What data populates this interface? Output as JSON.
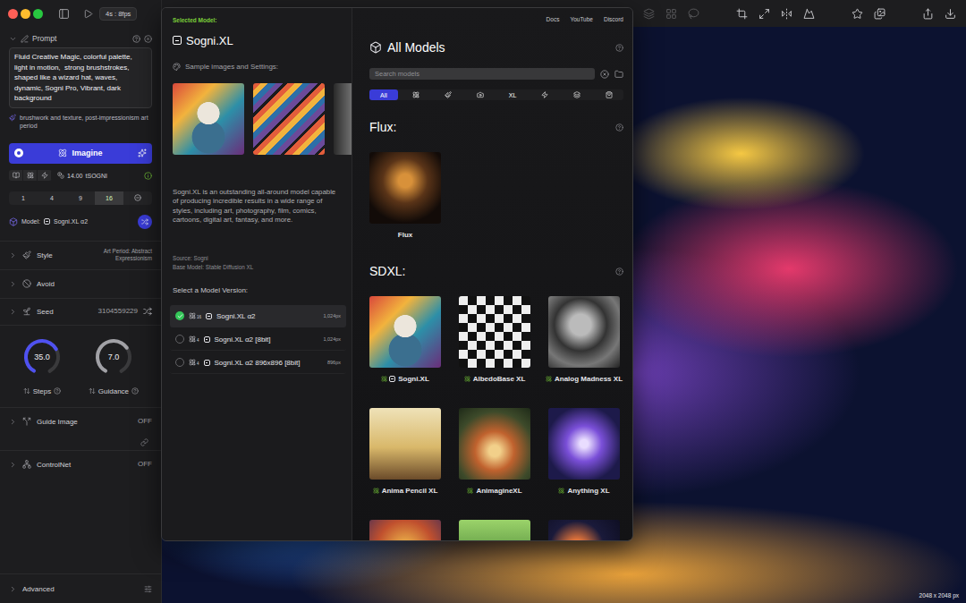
{
  "window": {
    "playback": "4s : 8fps"
  },
  "sidebar": {
    "prompt": {
      "label": "Prompt",
      "expanded": true,
      "text": "Fluid Creative Magic, colorful palette, light in motion,  strong brushstrokes, shaped like a wizard hat, waves, dynamic, Sogni Pro, Vibrant, dark background"
    },
    "style_hint": "brushwork and texture, post-impressionism art period",
    "imagine_button": "Imagine",
    "cost": {
      "amount": "14.00",
      "unit": "tSOGNI"
    },
    "batch": [
      {
        "label": "1",
        "selected": false
      },
      {
        "label": "4",
        "selected": false
      },
      {
        "label": "9",
        "selected": false
      },
      {
        "label": "16",
        "selected": true
      }
    ],
    "model": {
      "label": "Model:",
      "name": "Sogni.XL α2"
    },
    "sections": [
      {
        "label": "Style",
        "value": "Art Period: Abstract Expressionism",
        "expanded": false
      },
      {
        "label": "Avoid",
        "value": "",
        "expanded": false
      },
      {
        "label": "Seed",
        "value": "3104559229",
        "expanded": false
      }
    ],
    "dials": [
      {
        "label": "Steps",
        "value": "35.0",
        "level": 0.7,
        "color": "#4f51f0"
      },
      {
        "label": "Guidance",
        "value": "7.0",
        "level": 0.68,
        "color": "#a1a1a6"
      }
    ],
    "toggles": [
      {
        "label": "Guide Image",
        "value": "OFF",
        "expanded": false
      },
      {
        "label": "ControlNet",
        "value": "OFF",
        "expanded": false
      }
    ],
    "advanced": {
      "label": "Advanced",
      "expanded": false
    }
  },
  "toolbar": [
    {
      "disabled": true
    },
    {
      "disabled": true
    },
    {
      "disabled": true
    },
    {
      "disabled": false
    },
    {
      "disabled": false
    },
    {
      "disabled": false
    },
    {
      "disabled": false
    },
    {
      "disabled": false
    },
    {
      "disabled": false
    },
    {
      "disabled": false
    },
    {
      "disabled": false
    }
  ],
  "canvas": {
    "size": "2048 x 2048 px"
  },
  "model_picker": {
    "selected_label": "Selected Model:",
    "links": [
      "Docs",
      "YouTube",
      "Discord"
    ],
    "model": {
      "name": "Sogni.XL",
      "samples_label": "Sample images and Settings:",
      "samples": [
        {
          "kind": "image"
        },
        {
          "kind": "image"
        },
        {
          "kind": "image"
        }
      ],
      "description": "Sogni.XL is an outstanding all-around model capable of producing incredible results in a wide range of styles, including art, photography, film, comics, cartoons, digital art, fantasy, and more.",
      "source": "Source: Sogni",
      "base_model": "Base Model: Stable Diffusion XL",
      "versions_label": "Select a Model Version:",
      "versions": [
        {
          "name": "Sogni.XL α2",
          "steps": "16",
          "resolution": "1,024px",
          "selected": true
        },
        {
          "name": "Sogni.XL α2 [8bit]",
          "steps": "4",
          "resolution": "1,024px",
          "selected": false
        },
        {
          "name": "Sogni.XL α2 896x896 [8bit]",
          "steps": "4",
          "resolution": "896px",
          "selected": false
        }
      ]
    },
    "catalog": {
      "title": "All Models",
      "search": {
        "placeholder": "Search models"
      },
      "filters": [
        {
          "kind": "text",
          "label": "All",
          "selected": true
        },
        {
          "kind": "icon",
          "selected": false
        },
        {
          "kind": "icon",
          "selected": false
        },
        {
          "kind": "icon",
          "selected": false
        },
        {
          "kind": "text",
          "label": "XL",
          "selected": false
        },
        {
          "kind": "icon",
          "selected": false
        },
        {
          "kind": "icon",
          "selected": false
        },
        {
          "kind": "icon",
          "selected": false
        }
      ],
      "groups": [
        {
          "title": "Flux:",
          "models": [
            {
              "name": "Flux",
              "kind": "plain"
            }
          ]
        },
        {
          "title": "SDXL:",
          "models": [
            {
              "name": "Sogni.XL",
              "kind": "sogni"
            },
            {
              "name": "AlbedoBase XL",
              "kind": "community"
            },
            {
              "name": "Analog Madness XL",
              "kind": "community"
            },
            {
              "name": "Anima Pencil XL",
              "kind": "community"
            },
            {
              "name": "AnimagineXL",
              "kind": "community"
            },
            {
              "name": "Anything XL",
              "kind": "community"
            },
            {
              "name": "",
              "kind": "community"
            },
            {
              "name": "",
              "kind": "community"
            },
            {
              "name": "",
              "kind": "community"
            }
          ]
        }
      ]
    }
  }
}
